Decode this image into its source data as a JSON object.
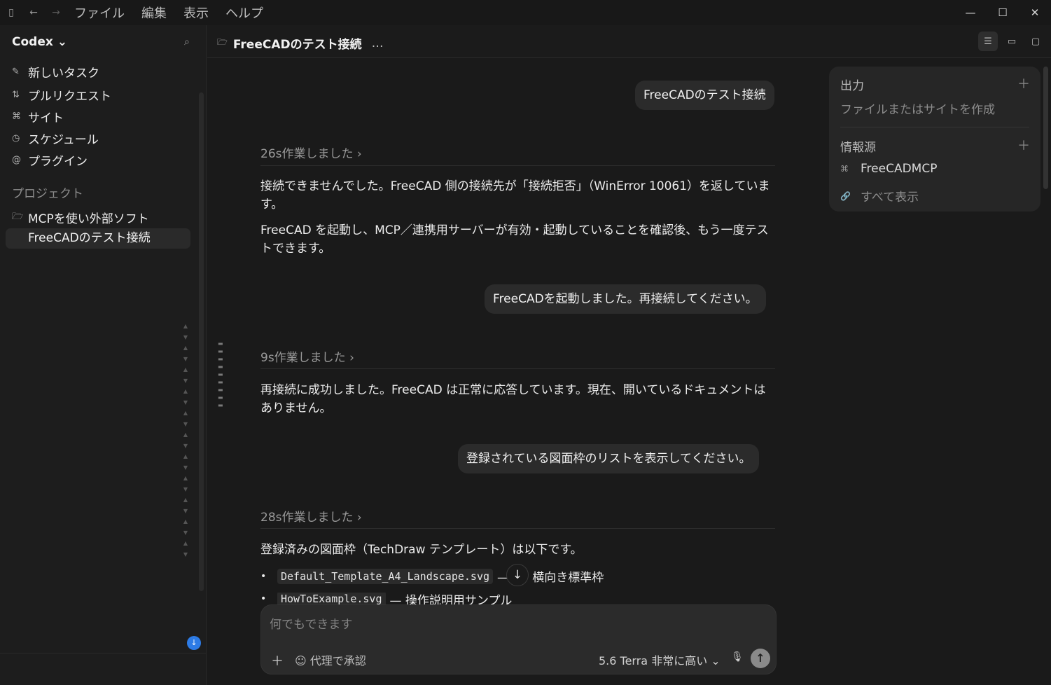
{
  "titlebar": {
    "menu": [
      "ファイル",
      "編集",
      "表示",
      "ヘルプ"
    ]
  },
  "sidebar": {
    "app_name": "Codex ⌄",
    "nav": [
      {
        "icon": "new-task-icon",
        "label": "新しいタスク"
      },
      {
        "icon": "pull-request-icon",
        "label": "プルリクエスト"
      },
      {
        "icon": "site-icon",
        "label": "サイト"
      },
      {
        "icon": "schedule-icon",
        "label": "スケジュール"
      },
      {
        "icon": "plugin-icon",
        "label": "プラグイン"
      }
    ],
    "projects_label": "プロジェクト",
    "project": "MCPを使い外部ソフト",
    "active_chat": "FreeCADのテスト接続"
  },
  "header": {
    "title": "FreeCADのテスト接続",
    "more": "…"
  },
  "conversation": {
    "user_1": "FreeCADのテスト接続",
    "worked_1": "26s作業しました ›",
    "reply_1a": "接続できませんでした。FreeCAD 側の接続先が「接続拒否」（WinError 10061）を返しています。",
    "reply_1b": "FreeCAD を起動し、MCP／連携用サーバーが有効・起動していることを確認後、もう一度テストできます。",
    "user_2": "FreeCADを起動しました。再接続してください。",
    "worked_2": "9s作業しました ›",
    "reply_2": "再接続に成功しました。FreeCAD は正常に応答しています。現在、開いているドキュメントはありません。",
    "user_3": "登録されている図面枠のリストを表示してください。",
    "worked_3": "28s作業しました ›",
    "reply_3": "登録済みの図面枠（TechDraw テンプレート）は以下です。",
    "items": [
      {
        "code": "Default_Template_A4_Landscape.svg",
        "desc": "— A4 横向き標準枠"
      },
      {
        "code": "HowToExample.svg",
        "desc": "— 操作説明用サンプル"
      }
    ]
  },
  "composer": {
    "placeholder": "何でもできます",
    "approve_label": "代理で承認",
    "model_label": "5.6 Terra 非常に高い ⌄"
  },
  "panel": {
    "output_title": "出力",
    "output_sub": "ファイルまたはサイトを作成",
    "sources_title": "情報源",
    "source_item": "FreeCADMCP",
    "show_all": "すべて表示"
  }
}
